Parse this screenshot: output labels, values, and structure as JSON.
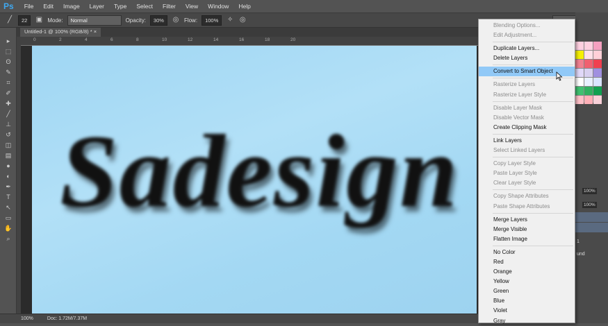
{
  "app": {
    "logo": "Ps",
    "menu": [
      "File",
      "Edit",
      "Image",
      "Layer",
      "Type",
      "Select",
      "Filter",
      "View",
      "Window",
      "Help"
    ]
  },
  "options": {
    "brush_size": "22",
    "mode_label": "Mode:",
    "mode_value": "Normal",
    "opacity_label": "Opacity:",
    "opacity_value": "30%",
    "flow_label": "Flow:",
    "flow_value": "100%"
  },
  "document": {
    "tab_title": "Untitled-1 @ 100% (RGB/8) *",
    "close": "×",
    "ruler_ticks": [
      "0",
      "2",
      "4",
      "6",
      "8",
      "10",
      "12",
      "14",
      "16",
      "18",
      "20"
    ],
    "artwork_text": "Sadesign"
  },
  "status": {
    "zoom": "100%",
    "doc": "Doc: 1.72M/7.37M"
  },
  "panels": {
    "opacity_value": "100%",
    "fill_value": "100%",
    "layer_name_fragment": "1",
    "layer_fragment2": "und"
  },
  "swatch_colors": [
    "#ffd0e0",
    "#ffd0e0",
    "#f5a0c0",
    "#f5f000",
    "#ffe0e8",
    "#ffd0d8",
    "#f08090",
    "#f06070",
    "#f04050",
    "#e0d8f8",
    "#d8d0f0",
    "#a090e0",
    "#ffffff",
    "#e8f0ff",
    "#d8e4ff",
    "#40c070",
    "#30b060",
    "#10a050",
    "#ffc0c8",
    "#ffb0b8",
    "#f8d0d8"
  ],
  "context_menu": {
    "items": [
      {
        "label": "Blending Options...",
        "state": "disabled"
      },
      {
        "label": "Edit Adjustment...",
        "state": "disabled",
        "sep_after": true
      },
      {
        "label": "Duplicate Layers...",
        "state": "enabled"
      },
      {
        "label": "Delete Layers",
        "state": "enabled",
        "sep_after": true
      },
      {
        "label": "Convert to Smart Object",
        "state": "highlighted",
        "sep_after": true
      },
      {
        "label": "Rasterize Layers",
        "state": "disabled"
      },
      {
        "label": "Rasterize Layer Style",
        "state": "disabled",
        "sep_after": true
      },
      {
        "label": "Disable Layer Mask",
        "state": "disabled"
      },
      {
        "label": "Disable Vector Mask",
        "state": "disabled"
      },
      {
        "label": "Create Clipping Mask",
        "state": "enabled",
        "sep_after": true
      },
      {
        "label": "Link Layers",
        "state": "enabled"
      },
      {
        "label": "Select Linked Layers",
        "state": "disabled",
        "sep_after": true
      },
      {
        "label": "Copy Layer Style",
        "state": "disabled"
      },
      {
        "label": "Paste Layer Style",
        "state": "disabled"
      },
      {
        "label": "Clear Layer Style",
        "state": "disabled",
        "sep_after": true
      },
      {
        "label": "Copy Shape Attributes",
        "state": "disabled"
      },
      {
        "label": "Paste Shape Attributes",
        "state": "disabled",
        "sep_after": true
      },
      {
        "label": "Merge Layers",
        "state": "enabled"
      },
      {
        "label": "Merge Visible",
        "state": "enabled"
      },
      {
        "label": "Flatten Image",
        "state": "enabled",
        "sep_after": true
      },
      {
        "label": "No Color",
        "state": "enabled"
      },
      {
        "label": "Red",
        "state": "enabled"
      },
      {
        "label": "Orange",
        "state": "enabled"
      },
      {
        "label": "Yellow",
        "state": "enabled"
      },
      {
        "label": "Green",
        "state": "enabled"
      },
      {
        "label": "Blue",
        "state": "enabled"
      },
      {
        "label": "Violet",
        "state": "enabled"
      },
      {
        "label": "Gray",
        "state": "enabled"
      }
    ]
  },
  "tools": [
    "move",
    "marquee",
    "lasso",
    "quick-select",
    "crop",
    "eyedropper",
    "healing",
    "brush",
    "clone-stamp",
    "history-brush",
    "eraser",
    "gradient",
    "blur",
    "dodge",
    "pen",
    "type",
    "path-select",
    "rectangle",
    "hand",
    "zoom"
  ]
}
